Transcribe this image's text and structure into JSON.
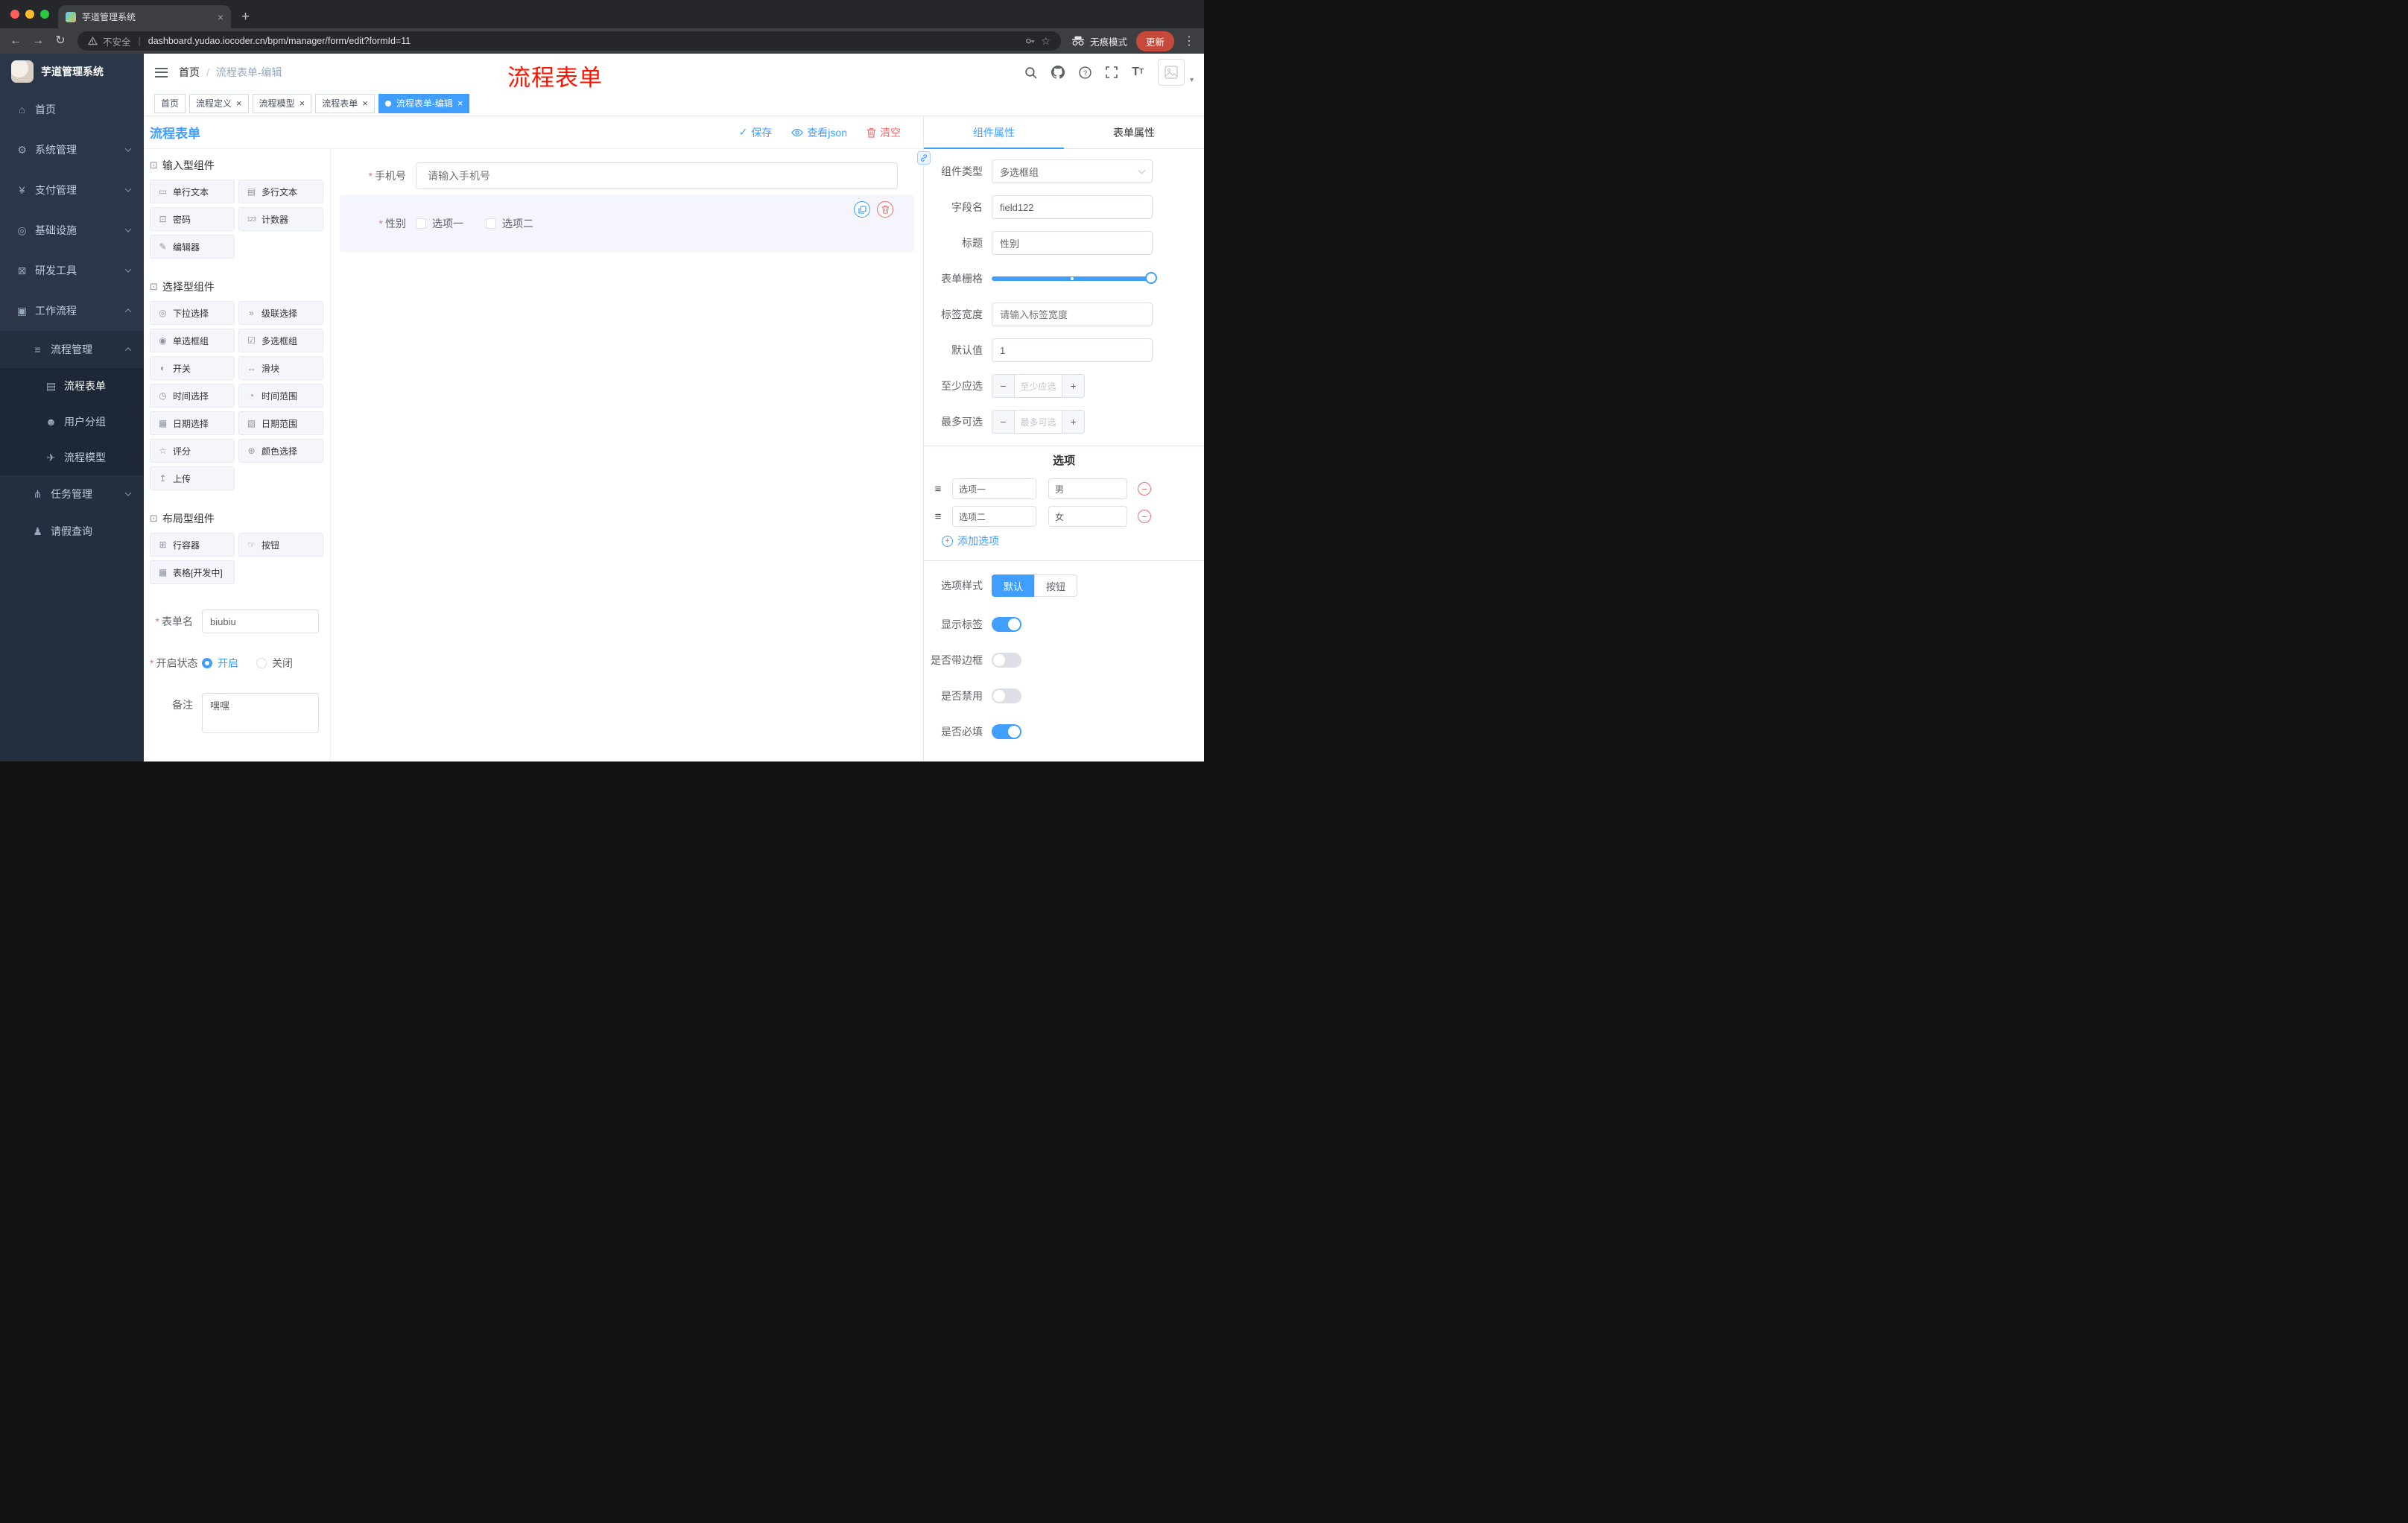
{
  "browser": {
    "tab_title": "芋道管理系统",
    "new_tab_glyph": "+",
    "security_label": "不安全",
    "url": "dashboard.yudao.iocoder.cn/bpm/manager/form/edit?formId=11",
    "incognito_label": "无痕模式",
    "update_label": "更新"
  },
  "sidebar": {
    "logo_title": "芋道管理系统",
    "menu": [
      {
        "label": "首页",
        "icon": "dashboard-icon"
      },
      {
        "label": "系统管理",
        "icon": "gear-icon",
        "chevron": "down"
      },
      {
        "label": "支付管理",
        "icon": "payment-icon",
        "chevron": "down"
      },
      {
        "label": "基础设施",
        "icon": "infrastructure-icon",
        "chevron": "down"
      },
      {
        "label": "研发工具",
        "icon": "devtools-icon",
        "chevron": "down"
      },
      {
        "label": "工作流程",
        "icon": "workflow-icon",
        "chevron": "up"
      },
      {
        "label": "流程管理",
        "icon": "process-manage-icon",
        "chevron": "up"
      },
      {
        "label": "流程表单",
        "icon": "process-form-icon"
      },
      {
        "label": "用户分组",
        "icon": "user-group-icon"
      },
      {
        "label": "流程模型",
        "icon": "process-model-icon"
      },
      {
        "label": "任务管理",
        "icon": "task-manage-icon",
        "chevron": "down"
      },
      {
        "label": "请假查询",
        "icon": "leave-query-icon"
      }
    ]
  },
  "header": {
    "breadcrumb_home": "首页",
    "breadcrumb_separator": "/",
    "breadcrumb_current": "流程表单-编辑",
    "annotation": "流程表单"
  },
  "tags": [
    {
      "label": "首页"
    },
    {
      "label": "流程定义"
    },
    {
      "label": "流程模型"
    },
    {
      "label": "流程表单"
    },
    {
      "label": "流程表单-编辑"
    }
  ],
  "designer": {
    "title": "流程表单",
    "actions": {
      "save": "保存",
      "view_json": "查看json",
      "clear": "清空"
    },
    "palette": {
      "groups": [
        {
          "title": "输入型组件",
          "items": [
            "单行文本",
            "多行文本",
            "密码",
            "计数器",
            "编辑器"
          ]
        },
        {
          "title": "选择型组件",
          "items": [
            "下拉选择",
            "级联选择",
            "单选框组",
            "多选框组",
            "开关",
            "滑块",
            "时间选择",
            "时间范围",
            "日期选择",
            "日期范围",
            "评分",
            "颜色选择",
            "上传"
          ]
        },
        {
          "title": "布局型组件",
          "items": [
            "行容器",
            "按钮",
            "表格[开发中]"
          ]
        }
      ]
    },
    "meta": {
      "form_name_label": "表单名",
      "form_name_value": "biubiu",
      "status_label": "开启状态",
      "status_on": "开启",
      "status_off": "关闭",
      "remark_label": "备注",
      "remark_value": "嘿嘿"
    },
    "canvas": {
      "phone_label": "手机号",
      "phone_placeholder": "请输入手机号",
      "gender_label": "性别",
      "gender_options": [
        "选项一",
        "选项二"
      ]
    }
  },
  "properties": {
    "tab_component": "组件属性",
    "tab_form": "表单属性",
    "component_type_label": "组件类型",
    "component_type_value": "多选框组",
    "field_name_label": "字段名",
    "field_name_value": "field122",
    "title_label": "标题",
    "title_value": "性别",
    "grid_label": "表单栅格",
    "label_width_label": "标签宽度",
    "label_width_placeholder": "请输入标签宽度",
    "default_label": "默认值",
    "default_value": "1",
    "min_label": "至少应选",
    "min_placeholder": "至少应选",
    "max_label": "最多可选",
    "max_placeholder": "最多可选",
    "options_title": "选项",
    "options": [
      {
        "label": "选项一",
        "value": "男"
      },
      {
        "label": "选项二",
        "value": "女"
      }
    ],
    "add_option": "添加选项",
    "style_label": "选项样式",
    "style_default": "默认",
    "style_button": "按钮",
    "toggle_show_label": "显示标签",
    "toggle_border": "是否带边框",
    "toggle_disabled": "是否禁用",
    "toggle_required": "是否必填"
  },
  "colors": {
    "accent": "#409EFF",
    "danger": "#F56C6C",
    "sidebar_bg": "#2B3649",
    "annotation_red": "#FE1400",
    "update_button_bg": "#C6493B"
  }
}
